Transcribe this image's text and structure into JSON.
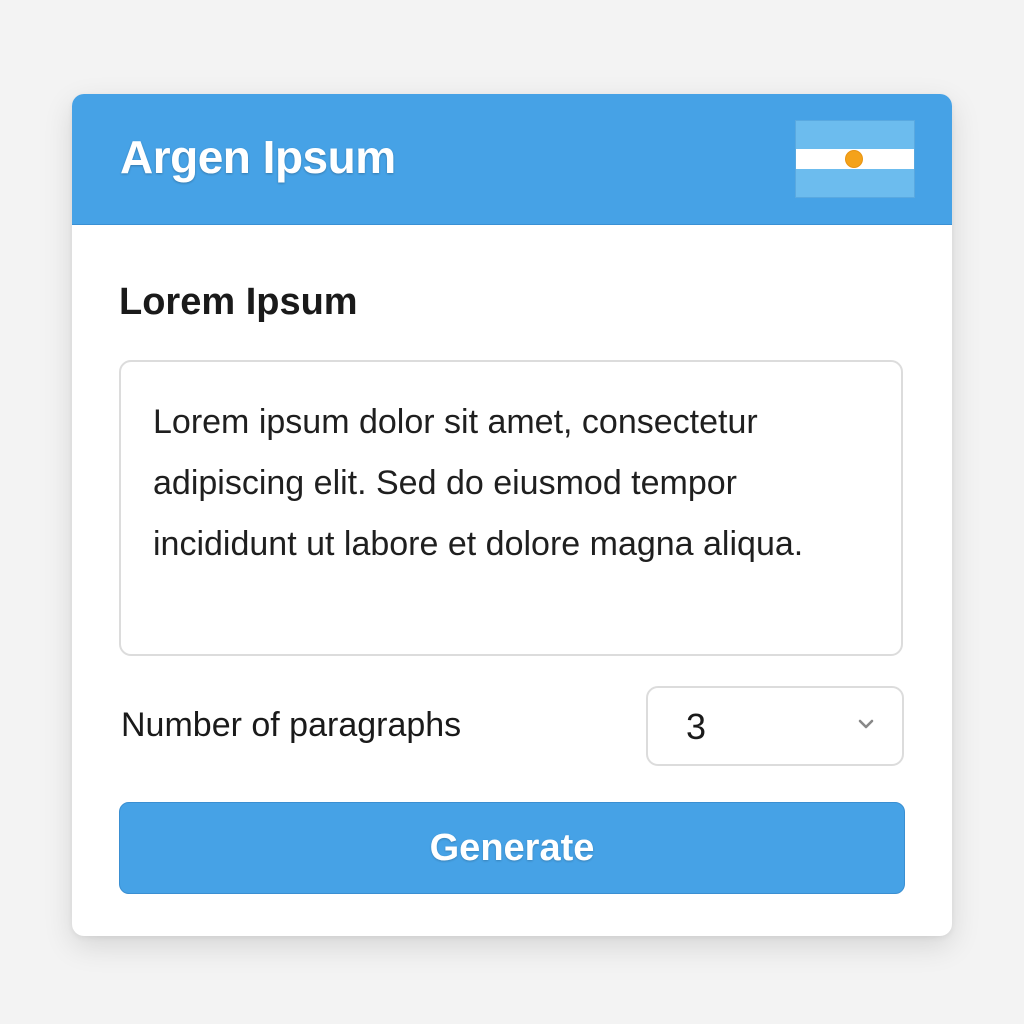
{
  "header": {
    "title": "Argen Ipsum",
    "flag_icon": "argentina-flag-icon",
    "accent_color": "#46a2e6"
  },
  "main": {
    "section_title": "Lorem Ipsum",
    "generated_text": "Lorem ipsum dolor sit amet, consectetur adipiscing elit. Sed do eiusmod tempor incididunt ut labore et dolore magna aliqua.",
    "paragraphs_label": "Number of paragraphs",
    "paragraphs_value": "3",
    "select_icon": "chevron-down-icon",
    "generate_label": "Generate"
  }
}
